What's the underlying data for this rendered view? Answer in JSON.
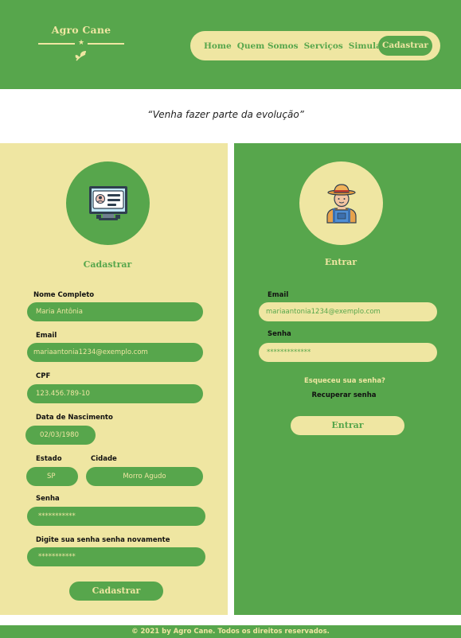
{
  "brand": {
    "name": "Agro Cane"
  },
  "nav": {
    "items": [
      "Home",
      "Quem Somos",
      "Serviços",
      "Simulador"
    ],
    "cta": "Cadastrar"
  },
  "tagline": "“Venha fazer parte da evolução”",
  "register": {
    "title": "Cadastrar",
    "fields": {
      "name": {
        "label": "Nome Completo",
        "value": "Maria Antônia"
      },
      "email": {
        "label": "Email",
        "value": "mariaantonia1234@exemplo.com"
      },
      "cpf": {
        "label": "CPF",
        "value": "123.456.789-10"
      },
      "birth": {
        "label": "Data de Nascimento",
        "value": "02/03/1980"
      },
      "state": {
        "label": "Estado",
        "value": "SP"
      },
      "city": {
        "label": "Cidade",
        "value": "Morro Agudo"
      },
      "password": {
        "label": "Senha",
        "value": "***********"
      },
      "password_confirm": {
        "label": "Digite sua senha senha novamente",
        "value": "***********"
      }
    },
    "submit": "Cadastrar",
    "icon": "computer-profile-icon"
  },
  "login": {
    "title": "Entrar",
    "fields": {
      "email": {
        "label": "Email",
        "value": "mariaantonia1234@exemplo.com"
      },
      "password": {
        "label": "Senha",
        "value": "*************"
      }
    },
    "forgot": "Esqueceu sua senha?",
    "recover": "Recuperar senha",
    "submit": "Entrar",
    "icon": "farmer-icon"
  },
  "footer": "© 2021 by Agro Cane. Todos os direitos reservados.",
  "colors": {
    "green": "#57a64c",
    "cream": "#efe6a2"
  }
}
